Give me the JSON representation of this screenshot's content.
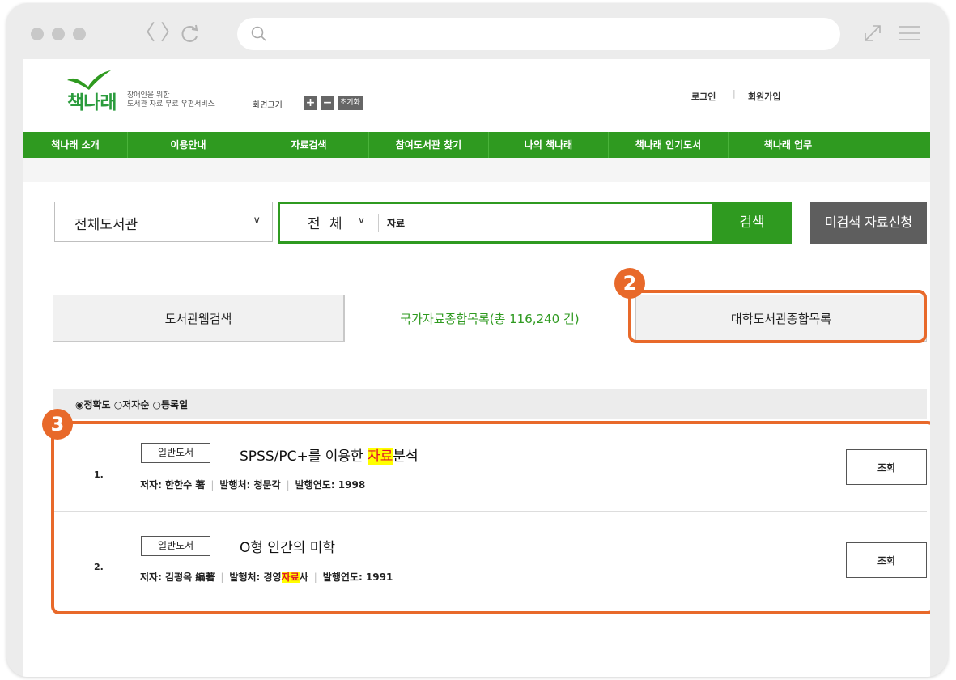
{
  "browser": {
    "back_glyph": "〈",
    "forward_glyph": "〉",
    "url_value": ""
  },
  "header": {
    "logo_text": "책나래",
    "tagline_line1": "장애인을 위한",
    "tagline_line2": "도서관 자료 무료 우편서비스",
    "screen_size_label": "화면크기",
    "zoom_in": "+",
    "zoom_out": "−",
    "reset_label": "초기화",
    "login": "로그인",
    "signup": "회원가입",
    "separator": "|"
  },
  "nav": {
    "items": [
      {
        "label": "책나래 소개"
      },
      {
        "label": "이용안내"
      },
      {
        "label": "자료검색"
      },
      {
        "label": "참여도서관 찾기"
      },
      {
        "label": "나의 책나래"
      },
      {
        "label": "책나래 인기도서"
      },
      {
        "label": "책나래 업무"
      }
    ]
  },
  "search": {
    "library_select": "전체도서관",
    "scope_select": "전 체",
    "query": "자료",
    "search_button": "검색",
    "request_button": "미검색 자료신청"
  },
  "tabs": [
    {
      "label": "도서관웹검색"
    },
    {
      "label": "국가자료종합목록(총 116,240 건)"
    },
    {
      "label": "대학도서관종합목록"
    }
  ],
  "sort": {
    "label": "◉정확도 ○저자순 ○등록일"
  },
  "results": [
    {
      "number": "1.",
      "type": "일반도서",
      "title_pre": "SPSS/PC+를 이용한 ",
      "title_mark": "자료",
      "title_post": "분석",
      "meta_author": "저자: 한한수 著",
      "meta_pub_pre": "발행처: 청문각",
      "meta_pub_mark": "",
      "meta_pub_post": "",
      "meta_year": "발행연도: 1998",
      "view_button": "조회"
    },
    {
      "number": "2.",
      "type": "일반도서",
      "title_pre": "O형 인간의 미학",
      "title_mark": "",
      "title_post": "",
      "meta_author": "저자: 김평옥 編著",
      "meta_pub_pre": "발행처: 경영",
      "meta_pub_mark": "자료",
      "meta_pub_post": "사",
      "meta_year": "발행연도: 1991",
      "view_button": "조회"
    }
  ],
  "annotations": {
    "badge_2": "2",
    "badge_3": "3"
  },
  "colors": {
    "brand_green": "#2f9a20",
    "annotation_orange": "#e8692a",
    "highlight_yellow": "#ffff00"
  }
}
